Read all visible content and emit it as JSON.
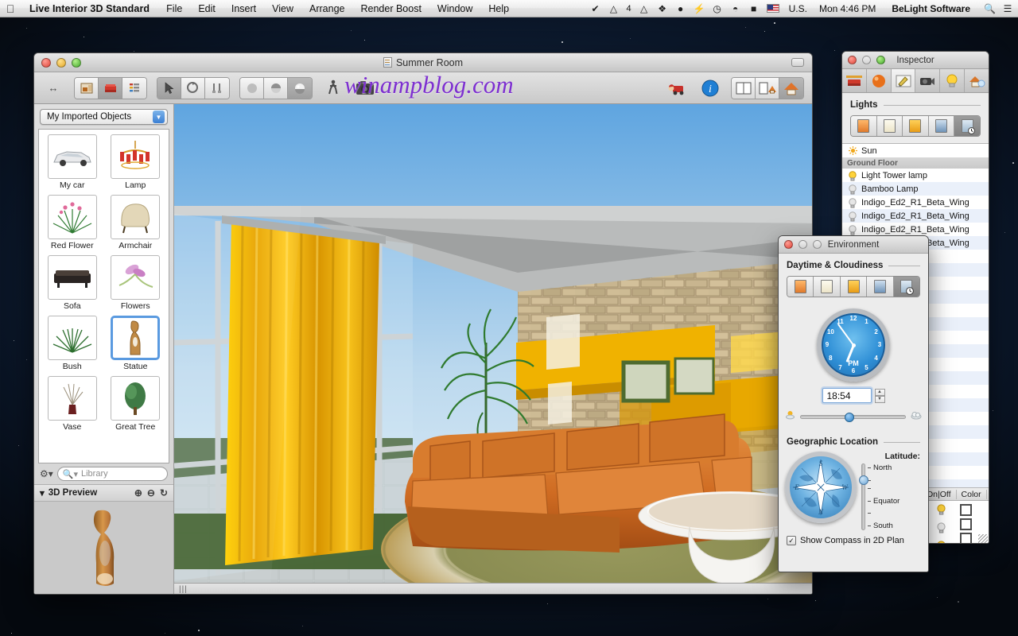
{
  "menubar": {
    "apple_icon": "apple-logo",
    "app_name": "Live Interior 3D Standard",
    "items": [
      "File",
      "Edit",
      "Insert",
      "View",
      "Arrange",
      "Render Boost",
      "Window",
      "Help"
    ],
    "status_icons": [
      "checkmark-badge-icon",
      "adobe-icon",
      "google-drive-icon",
      "dropbox-icon",
      "evernote-icon",
      "flash-icon",
      "clock-icon",
      "wifi-icon",
      "battery-icon"
    ],
    "adobe_count": "4",
    "input_flag": "us-flag-icon",
    "input_source": "U.S.",
    "clock": "Mon 4:46 PM",
    "user": "BeLight Software",
    "spotlight_icon": "search-icon",
    "notification_icon": "list-icon"
  },
  "window": {
    "title": "Summer Room",
    "doc_icon": "document-icon",
    "collapse_icon": "collapse-toolbar-icon",
    "watermark": "winampblog.com",
    "toolbar": {
      "groups": [
        {
          "name": "resize-handle",
          "icons": [
            "left-right-arrows-icon"
          ]
        },
        {
          "name": "editor-mode",
          "icons": [
            "floor-plan-icon",
            "furniture-icon",
            "list-view-icon"
          ],
          "active_index": 1
        },
        {
          "name": "tools",
          "icons": [
            "arrow-select-icon",
            "rotate-icon",
            "measure-icon"
          ],
          "active_index": 0
        },
        {
          "name": "render-quality",
          "icons": [
            "flat-shading-icon",
            "smooth-shading-icon",
            "glossy-shading-icon"
          ],
          "active_index": 2
        },
        {
          "name": "walkthrough",
          "icons": [
            "walk-person-icon",
            "camera-icon"
          ]
        },
        {
          "name": "utility",
          "icons": [
            "santa-truck-icon",
            "info-icon"
          ]
        },
        {
          "name": "view-layout",
          "icons": [
            "split-view-icon",
            "plan-3d-view-icon",
            "house-3d-view-icon"
          ],
          "active_index": 2
        }
      ]
    },
    "status_grip": "resize-grip"
  },
  "library": {
    "category_label": "My Imported Objects",
    "dropdown_icon": "chevron-down-icon",
    "objects": [
      {
        "name": "My car",
        "icon": "car-thumbnail",
        "selected": false
      },
      {
        "name": "Lamp",
        "icon": "chandelier-thumbnail",
        "selected": false
      },
      {
        "name": "Red Flower",
        "icon": "red-flower-thumbnail",
        "selected": false
      },
      {
        "name": "Armchair",
        "icon": "armchair-thumbnail",
        "selected": false
      },
      {
        "name": "Sofa",
        "icon": "sofa-thumbnail",
        "selected": false
      },
      {
        "name": "Flowers",
        "icon": "flowers-thumbnail",
        "selected": false
      },
      {
        "name": "Bush",
        "icon": "bush-thumbnail",
        "selected": false
      },
      {
        "name": "Statue",
        "icon": "statue-thumbnail",
        "selected": true
      },
      {
        "name": "Vase",
        "icon": "vase-thumbnail",
        "selected": false
      },
      {
        "name": "Great Tree",
        "icon": "tree-thumbnail",
        "selected": false
      }
    ],
    "gear_icon": "gear-icon",
    "search_icon": "search-icon",
    "search_placeholder": "Library",
    "search_value": "",
    "preview": {
      "disclosure_icon": "triangle-down-icon",
      "title": "3D Preview",
      "zoom_in_icon": "zoom-in-icon",
      "zoom_out_icon": "zoom-out-icon",
      "reset_icon": "rotate-reset-icon",
      "object": "statue-3d-preview"
    }
  },
  "inspector": {
    "title": "Inspector",
    "tabs": [
      {
        "icon": "object-properties-icon",
        "active": false
      },
      {
        "icon": "material-sphere-icon",
        "active": false
      },
      {
        "icon": "edit-pencil-icon",
        "active": true
      },
      {
        "icon": "camera-icon",
        "active": false
      },
      {
        "icon": "light-bulb-icon",
        "active": false
      },
      {
        "icon": "house-environment-icon",
        "active": false
      }
    ],
    "section_title": "Lights",
    "light_modes": [
      {
        "icon": "sunset-window-icon",
        "active": false
      },
      {
        "icon": "day-window-icon",
        "active": false
      },
      {
        "icon": "evening-window-icon",
        "active": false
      },
      {
        "icon": "night-window-icon",
        "active": false
      },
      {
        "icon": "custom-time-window-icon",
        "active": true
      }
    ],
    "lights": [
      {
        "label": "Sun",
        "icon": "sun-icon",
        "group": false
      },
      {
        "label": "Ground Floor",
        "icon": "",
        "group": true
      },
      {
        "label": "Light Tower lamp",
        "icon": "bulb-on-icon",
        "group": false
      },
      {
        "label": "Bamboo Lamp",
        "icon": "bulb-off-icon",
        "group": false
      },
      {
        "label": "Indigo_Ed2_R1_Beta_Wing",
        "icon": "bulb-off-icon",
        "group": false
      },
      {
        "label": "Indigo_Ed2_R1_Beta_Wing",
        "icon": "bulb-off-icon",
        "group": false
      },
      {
        "label": "Indigo_Ed2_R1_Beta_Wing",
        "icon": "bulb-off-icon",
        "group": false
      },
      {
        "label": "Indigo_Ed2_R1_Beta_Wing",
        "icon": "bulb-off-icon",
        "group": false
      }
    ],
    "columns": [
      "On|Off",
      "Color"
    ],
    "column_rows": [
      {
        "bulb": "bulb-on-icon",
        "color": "#ffffff"
      },
      {
        "bulb": "bulb-off-icon",
        "color": "#ffffff"
      },
      {
        "bulb": "bulb-on-icon",
        "color": "#ffffff"
      }
    ]
  },
  "environment": {
    "title": "Environment",
    "daytime_section": "Daytime & Cloudiness",
    "daytime_modes": [
      {
        "icon": "sunset-window-icon",
        "active": false
      },
      {
        "icon": "day-window-icon",
        "active": false
      },
      {
        "icon": "evening-window-icon",
        "active": false
      },
      {
        "icon": "night-window-icon",
        "active": false
      },
      {
        "icon": "custom-time-window-icon",
        "active": true
      }
    ],
    "clock": {
      "numbers": [
        "12",
        "1",
        "2",
        "3",
        "4",
        "5",
        "6",
        "7",
        "8",
        "9",
        "10",
        "11"
      ],
      "meridiem": "PM",
      "hour_angle_deg": 202,
      "minute_angle_deg": 324
    },
    "time_value": "18:54",
    "stepper_up_icon": "stepper-up-icon",
    "stepper_down_icon": "stepper-down-icon",
    "cloudiness": {
      "sun_icon": "sun-small-icon",
      "cloud_icon": "cloud-small-icon",
      "value_percent": 42
    },
    "geo_section": "Geographic Location",
    "compass_icon": "compass-rose-icon",
    "latitude_label": "Latitude:",
    "latitude_ticks": [
      "North",
      "",
      "",
      "Equator",
      "",
      "South"
    ],
    "latitude_value_percent": 17,
    "compass_checkbox": {
      "label": "Show Compass in 2D Plan",
      "checked": true,
      "check_icon": "checkmark-icon"
    }
  }
}
